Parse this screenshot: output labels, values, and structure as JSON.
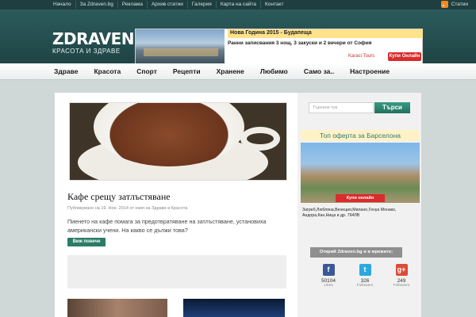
{
  "topbar": {
    "items": [
      "Начало",
      "За Zdraven.bg",
      "Реклама",
      "Архив статии",
      "Галерия",
      "Карта на сайта",
      "Контакт"
    ],
    "rss_label": "Статии"
  },
  "logo": {
    "main": "ZDRAVEN.BG",
    "sub": "КРАСОТА И ЗДРАВЕ"
  },
  "ad": {
    "title": "Нова Година 2015 - Будапеща",
    "text": "Ранни записвания 3 нощ. 3 закуски и 2 вечери от София",
    "brand": "Karaci Tours",
    "button": "Купи Онлайн"
  },
  "nav": {
    "items": [
      "Здраве",
      "Красота",
      "Спорт",
      "Рецепти",
      "Хранене",
      "Любимо",
      "Само за..",
      "Настроение"
    ]
  },
  "article": {
    "title": "Кафе срещу затлъстяване",
    "meta_prefix": "Публикувано на 19. Ное. 2014 от",
    "meta_author": "екип",
    "meta_in": "на",
    "meta_categories": "Здраве и Красота",
    "text": "Пиенето на кафе помага за предотвратяване на затлъстяване, установиха американски учени. На какво се дължи това?",
    "more_button": "Виж повече"
  },
  "sidebar": {
    "search_placeholder": "Търсене тук",
    "search_button": "Търси",
    "offer_title": "Топ оферта за Барселона",
    "offer_button": "Купи онлайн",
    "offer_text": "Загреб,Любляна,Венеция,Милано,Генуа Монако, Андора,Кан,Ница и др. 794ЛВ",
    "social_title": "Открий Zdraven.bg и в мрежите:",
    "social": [
      {
        "icon": "f",
        "count": "50104",
        "label": "Likes",
        "color": "#3b5998"
      },
      {
        "icon": "t",
        "count": "326",
        "label": "Followers",
        "color": "#2aa9e0"
      },
      {
        "icon": "g+",
        "count": "249",
        "label": "Followers",
        "color": "#dd4b39"
      }
    ]
  }
}
